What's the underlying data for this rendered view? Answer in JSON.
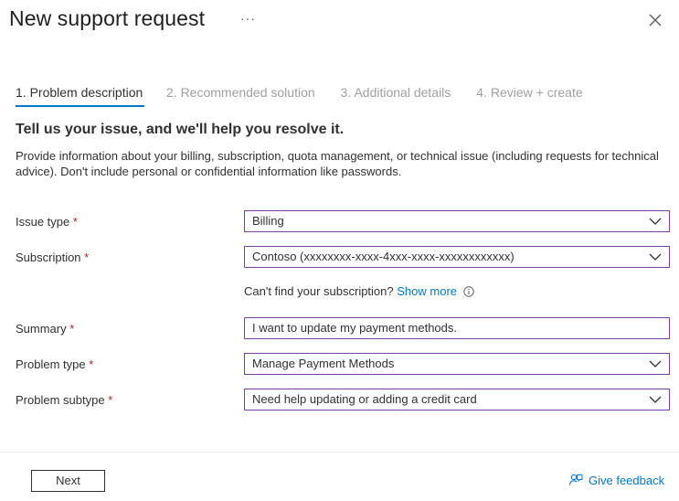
{
  "header": {
    "title": "New support request",
    "more_label": "···"
  },
  "tabs": [
    {
      "label": "1. Problem description",
      "active": true
    },
    {
      "label": "2. Recommended solution",
      "active": false
    },
    {
      "label": "3. Additional details",
      "active": false
    },
    {
      "label": "4. Review + create",
      "active": false
    }
  ],
  "form": {
    "heading": "Tell us your issue, and we'll help you resolve it.",
    "description": "Provide information about your billing, subscription, quota management, or technical issue (including requests for technical advice). Don't include personal or confidential information like passwords.",
    "required_marker": "*",
    "issue_type": {
      "label": "Issue type",
      "value": "Billing"
    },
    "subscription": {
      "label": "Subscription",
      "value": "Contoso (xxxxxxxx-xxxx-4xxx-xxxx-xxxxxxxxxxxx)",
      "hint": "Can't find your subscription?",
      "hint_link": "Show more"
    },
    "summary": {
      "label": "Summary",
      "value": "I want to update my payment methods."
    },
    "problem_type": {
      "label": "Problem type",
      "value": "Manage Payment Methods"
    },
    "problem_subtype": {
      "label": "Problem subtype",
      "value": "Need help updating or adding a credit card"
    }
  },
  "footer": {
    "next_label": "Next",
    "feedback_label": "Give feedback"
  },
  "colors": {
    "accent": "#0078d4",
    "focus_border": "#7b3fa8",
    "required": "#a4262c"
  },
  "icons": [
    "more-icon",
    "close-icon",
    "chevron-down-icon",
    "info-icon",
    "feedback-icon"
  ]
}
